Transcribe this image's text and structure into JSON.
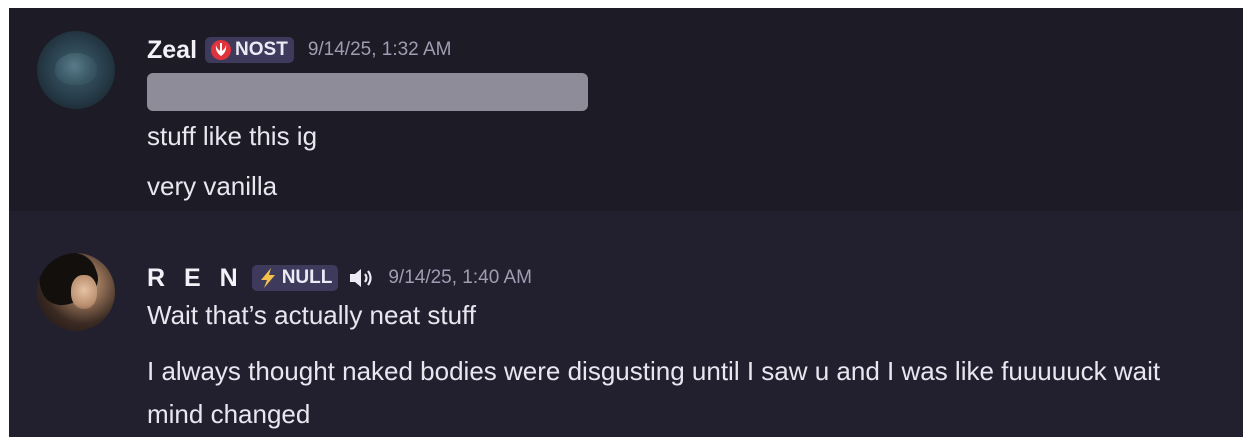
{
  "messages": [
    {
      "username": "Zeal",
      "tag": {
        "label": "NOST",
        "icon": "rebel-alliance-icon",
        "icon_color": "#e0343c"
      },
      "timestamp": "9/14/25, 1:32 AM",
      "content": [
        "stuff like this ig",
        "very vanilla"
      ]
    },
    {
      "username": "R E N",
      "tag": {
        "label": "NULL",
        "icon": "lightning-bolt-icon",
        "icon_color": "#f2c24a"
      },
      "status_icon": "speaker-icon",
      "timestamp": "9/14/25, 1:40 AM",
      "content": [
        "Wait that’s actually neat stuff",
        "I always thought naked bodies were disgusting until I saw u and I was like fuuuuuck wait mind changed"
      ]
    }
  ],
  "colors": {
    "background": "#1c1b26",
    "highlight_background": "#22202e",
    "tag_background": "#3d3a5c",
    "redacted_block": "#8d8c98"
  }
}
